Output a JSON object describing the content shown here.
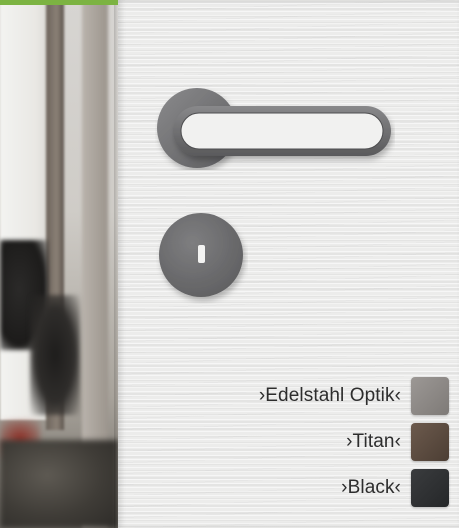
{
  "finishes": [
    {
      "label": "›Edelstahl Optik‹",
      "color": "#8e8a87"
    },
    {
      "label": "›Titan‹",
      "color": "#5d4d41"
    },
    {
      "label": "›Black‹",
      "color": "#2f3133"
    }
  ],
  "colors": {
    "accent": "#7cb342",
    "door": "#ececeb",
    "handle": "#6f6f71"
  },
  "icons": {
    "handle": "door-handle-icon",
    "rosette": "key-rosette-icon"
  }
}
